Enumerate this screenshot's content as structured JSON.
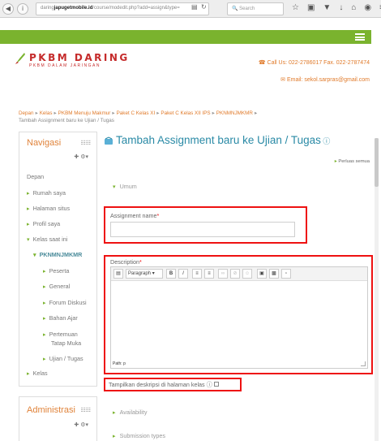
{
  "browser": {
    "url_prefix": "daring",
    "url_domain": "japugetmobile.id",
    "url_path": "/course/modedit.php?add=assign&type=",
    "search_placeholder": "Search"
  },
  "site": {
    "title": "PKBM DARING",
    "subtitle": "PKBM DALAM JARINGAN",
    "call": "Call Us: 022-2786017 Fax. 022-2787474",
    "email": "Email: sekol.sarpras@gmail.com"
  },
  "breadcrumb": {
    "items": [
      "Depan",
      "Kelas",
      "PKBM Menuju Makmur",
      "Paket C Kelas XI",
      "Paket C Kelas XII IPS",
      "PKNMNJMKMR"
    ],
    "current": "Tambah Assignment baru ke Ujian / Tugas"
  },
  "sidebar": {
    "nav_title": "Navigasi",
    "nav_items": [
      {
        "label": "Depan"
      },
      {
        "label": "Rumah saya"
      },
      {
        "label": "Halaman situs"
      },
      {
        "label": "Profil saya"
      },
      {
        "label": "Kelas saat ini"
      },
      {
        "label": "PKNMNJMKMR"
      },
      {
        "label": "Peserta"
      },
      {
        "label": "General"
      },
      {
        "label": "Forum Diskusi"
      },
      {
        "label": "Bahan Ajar"
      },
      {
        "label": "Pertemuan"
      },
      {
        "label": "Tatap Muka"
      },
      {
        "label": "Ujian / Tugas"
      },
      {
        "label": "Kelas"
      }
    ],
    "admin_title": "Administrasi"
  },
  "main": {
    "heading": "Tambah Assignment baru ke Ujian / Tugas",
    "expand_all": "Perluas semua",
    "section_general": "Umum",
    "assignment_name_label": "Assignment name",
    "assignment_name_value": "",
    "description_label": "Description",
    "paragraph_label": "Paragraph",
    "editor_path": "Path: p",
    "show_description_label": "Tampilkan deskripsi di halaman kelas",
    "section_availability": "Availability",
    "section_submission": "Submission types"
  },
  "colors": {
    "accent_green": "#7ab32e",
    "brand_red": "#c52b2b",
    "orange": "#e07a2a",
    "heading_blue": "#2a8aa6",
    "highlight_red": "#e11111"
  }
}
